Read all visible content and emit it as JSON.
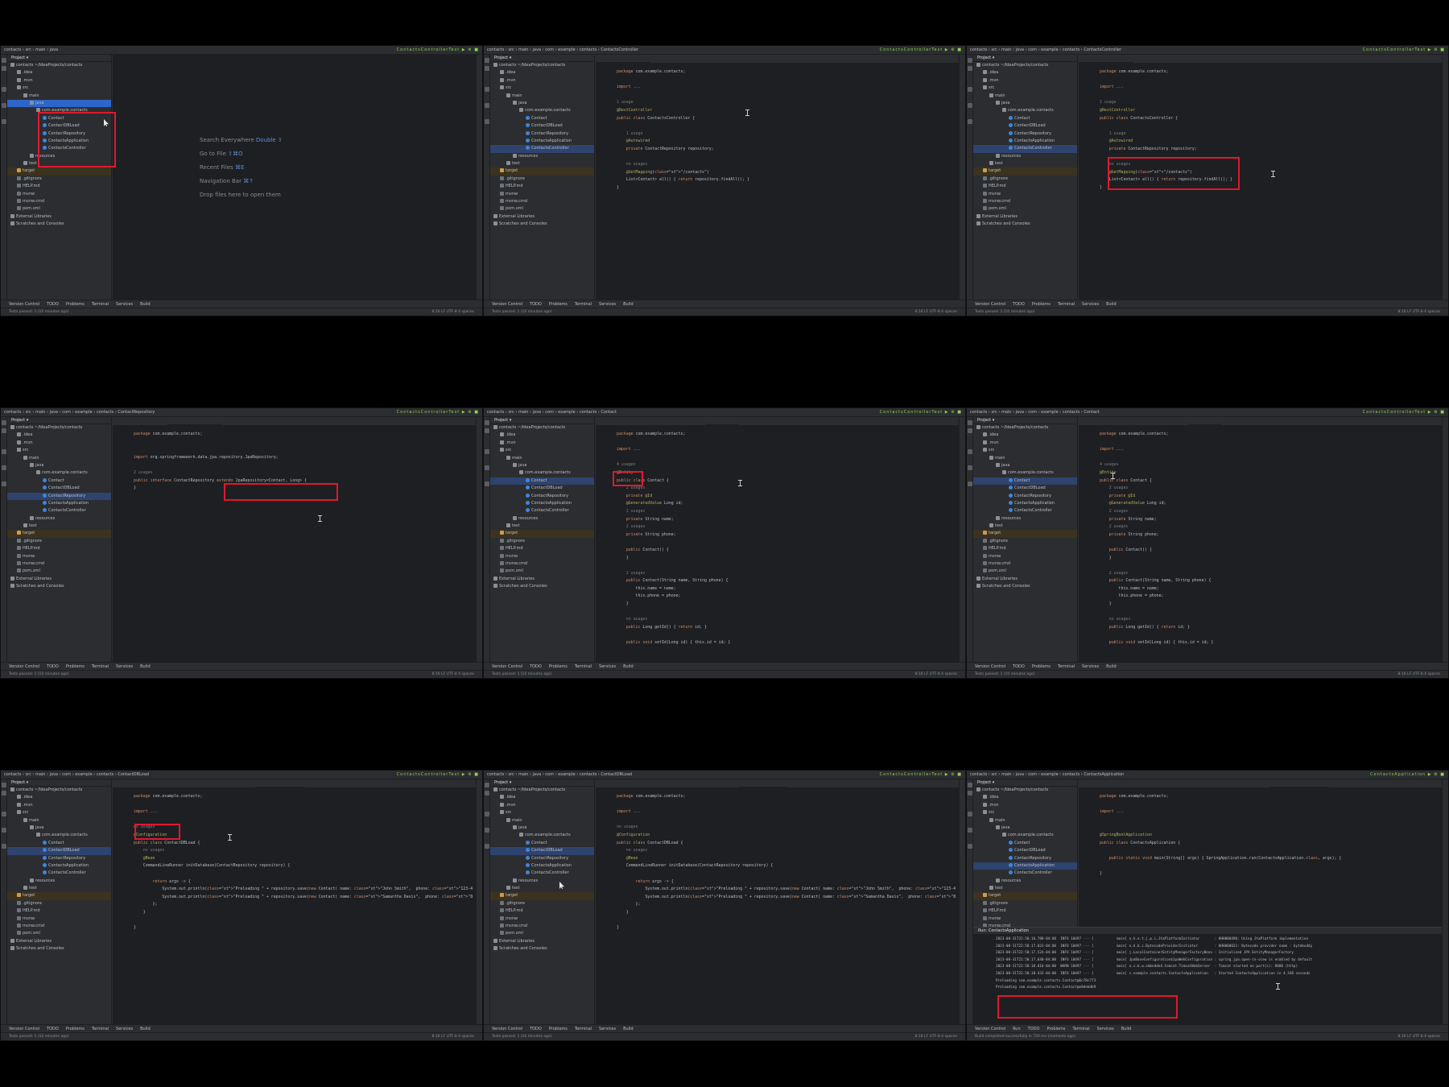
{
  "common": {
    "project_label": "Project",
    "project_root": "contacts",
    "project_root_path": "~/IdeaProjects/contacts",
    "bottom_tools": [
      "Version Control",
      "TODO",
      "Problems",
      "Terminal",
      "Services",
      "Build"
    ],
    "status_text": "Tests passed: 1 (10 minutes ago)",
    "status_right": "8:16   LF   UTF-8   4 spaces",
    "tree_items": [
      {
        "label": "contacts  ~/IdeaProjects/contacts",
        "indent": 0,
        "icon": "folder"
      },
      {
        "label": ".idea",
        "indent": 1,
        "icon": "folder"
      },
      {
        "label": ".mvn",
        "indent": 1,
        "icon": "folder"
      },
      {
        "label": "src",
        "indent": 1,
        "icon": "folder"
      },
      {
        "label": "main",
        "indent": 2,
        "icon": "folder"
      },
      {
        "label": "java",
        "indent": 3,
        "icon": "folder"
      },
      {
        "label": "com.example.contacts",
        "indent": 4,
        "icon": "folder"
      },
      {
        "label": "Contact",
        "indent": 5,
        "icon": "cls"
      },
      {
        "label": "ContactDBLoad",
        "indent": 5,
        "icon": "cls"
      },
      {
        "label": "ContactRepository",
        "indent": 5,
        "icon": "cls"
      },
      {
        "label": "ContactsApplication",
        "indent": 5,
        "icon": "cls"
      },
      {
        "label": "ContactsController",
        "indent": 5,
        "icon": "cls"
      },
      {
        "label": "resources",
        "indent": 3,
        "icon": "folder"
      },
      {
        "label": "test",
        "indent": 2,
        "icon": "folder"
      },
      {
        "label": "target",
        "indent": 1,
        "icon": "orangef"
      },
      {
        "label": ".gitignore",
        "indent": 1,
        "icon": "file"
      },
      {
        "label": "HELP.md",
        "indent": 1,
        "icon": "file"
      },
      {
        "label": "mvnw",
        "indent": 1,
        "icon": "file"
      },
      {
        "label": "mvnw.cmd",
        "indent": 1,
        "icon": "file"
      },
      {
        "label": "pom.xml",
        "indent": 1,
        "icon": "file"
      },
      {
        "label": "External Libraries",
        "indent": 0,
        "icon": "folder"
      },
      {
        "label": "Scratches and Consoles",
        "indent": 0,
        "icon": "folder"
      }
    ]
  },
  "panels": [
    {
      "breadcrumb": "contacts › src › main › java",
      "run_config": "ContactsControllerTest",
      "tabs": [],
      "active_tab": -1,
      "selected_tree": 5,
      "selected_style": "selbright",
      "empty_hints": [
        {
          "text": "Search Everywhere",
          "key": "Double ⇧"
        },
        {
          "text": "Go to File",
          "key": "⇧⌘O"
        },
        {
          "text": "Recent Files",
          "key": "⌘E"
        },
        {
          "text": "Navigation Bar",
          "key": "⌘↑"
        },
        {
          "text": "Drop files here to open them",
          "key": ""
        }
      ],
      "code": []
    },
    {
      "breadcrumb": "contacts › src › main › java › com › example › contacts › ContactsController",
      "run_config": "ContactsControllerTest",
      "tabs": [
        "ContactsController.java"
      ],
      "active_tab": 0,
      "selected_tree": 11,
      "selected_style": "sel",
      "code": [
        "package com.example.contacts;",
        "",
        "import ...",
        "",
        "1 usage",
        "@RestController",
        "public class ContactsController {",
        "",
        "    1 usage",
        "    @Autowired",
        "    private ContactRepository repository;",
        "",
        "    no usages",
        "    @GetMapping(\"/contacts\")",
        "    List<Contact> all() { return repository.findAll(); }",
        "}"
      ]
    },
    {
      "breadcrumb": "contacts › src › main › java › com › example › contacts › ContactsController",
      "run_config": "ContactsControllerTest",
      "tabs": [
        "ContactsController.java"
      ],
      "active_tab": 0,
      "selected_tree": 11,
      "selected_style": "sel",
      "code": [
        "package com.example.contacts;",
        "",
        "import ...",
        "",
        "1 usage",
        "@RestController",
        "public class ContactsController {",
        "",
        "    1 usage",
        "    @Autowired",
        "    private ContactRepository repository;",
        "",
        "    no usages",
        "    @GetMapping(\"/contacts\")",
        "    List<Contact> all() { return repository.findAll(); }",
        "}"
      ]
    },
    {
      "breadcrumb": "contacts › src › main › java › com › example › contacts › ContactRepository",
      "run_config": "ContactsControllerTest",
      "tabs": [
        "ContactsController.java",
        "ContactRepository.java"
      ],
      "active_tab": 1,
      "selected_tree": 9,
      "selected_style": "sel",
      "code": [
        "package com.example.contacts;",
        "",
        "",
        "import org.springframework.data.jpa.repository.JpaRepository;",
        "",
        "2 usages",
        "public interface ContactRepository extends JpaRepository<Contact, Long> {",
        "}"
      ]
    },
    {
      "breadcrumb": "contacts › src › main › java › com › example › contacts › Contact",
      "run_config": "ContactsControllerTest",
      "tabs": [
        "ContactsController.java",
        "ContactRepository.java",
        "Contact.java"
      ],
      "active_tab": 2,
      "selected_tree": 7,
      "selected_style": "sel",
      "code": [
        "package com.example.contacts;",
        "",
        "import ...",
        "",
        "4 usages",
        "@Entity",
        "public class Contact {",
        "    2 usages",
        "    private @Id",
        "    @GeneratedValue Long id;",
        "    2 usages",
        "    private String name;",
        "    2 usages",
        "    private String phone;",
        "",
        "    public Contact() {",
        "    }",
        "",
        "    2 usages",
        "    public Contact(String name, String phone) {",
        "        this.name = name;",
        "        this.phone = phone;",
        "    }",
        "",
        "    no usages",
        "    public Long getId() { return id; }",
        "",
        "    public void setId(Long id) { this.id = id; }"
      ]
    },
    {
      "breadcrumb": "contacts › src › main › java › com › example › contacts › Contact",
      "run_config": "ContactsControllerTest",
      "tabs": [
        "ContactsController.java",
        "ContactRepository.java",
        "Contact.java"
      ],
      "active_tab": 2,
      "selected_tree": 7,
      "selected_style": "sel",
      "code": [
        "package com.example.contacts;",
        "",
        "import ...",
        "",
        "4 usages",
        "@Entity",
        "public class Contact {",
        "    2 usages",
        "    private @Id",
        "    @GeneratedValue Long id;",
        "    2 usages",
        "    private String name;",
        "    2 usages",
        "    private String phone;",
        "",
        "    public Contact() {",
        "    }",
        "",
        "    2 usages",
        "    public Contact(String name, String phone) {",
        "        this.name = name;",
        "        this.phone = phone;",
        "    }",
        "",
        "    no usages",
        "    public Long getId() { return id; }",
        "",
        "    public void setId(Long id) { this.id = id; }"
      ]
    },
    {
      "breadcrumb": "contacts › src › main › java › com › example › contacts › ContactDBLoad",
      "run_config": "ContactsControllerTest",
      "tabs": [
        "ContactsController.java",
        "ContactRepository.java",
        "Contact.java",
        "ContactDBLoad.java"
      ],
      "active_tab": 3,
      "selected_tree": 8,
      "selected_style": "sel",
      "code": [
        "package com.example.contacts;",
        "",
        "import ...",
        "",
        "no usages",
        "@Configuration",
        "public class ContactDBLoad {",
        "    no usages",
        "    @Bean",
        "    CommandLineRunner initDatabase(ContactRepository repository) {",
        "",
        "        return args -> {",
        "            System.out.println(\"Preloading \" + repository.save(new Contact( name: \"John Smith\",  phone: \"123-456-7890\")));",
        "            System.out.println(\"Preloading \" + repository.save(new Contact( name: \"Samantha Davis\",  phone: \"890-765-4321\")));",
        "        };",
        "    }",
        "",
        "}"
      ]
    },
    {
      "breadcrumb": "contacts › src › main › java › com › example › contacts › ContactDBLoad",
      "run_config": "ContactsControllerTest",
      "tabs": [
        "ContactsController.java",
        "ContactRepository.java",
        "Contact.java",
        "ContactDBLoad.java"
      ],
      "active_tab": 3,
      "selected_tree": 8,
      "selected_style": "sel",
      "code": [
        "package com.example.contacts;",
        "",
        "import ...",
        "",
        "no usages",
        "@Configuration",
        "public class ContactDBLoad {",
        "    no usages",
        "    @Bean",
        "    CommandLineRunner initDatabase(ContactRepository repository) {",
        "",
        "        return args -> {",
        "            System.out.println(\"Preloading \" + repository.save(new Contact( name: \"John Smith\",  phone: \"123-456-7890\")));",
        "            System.out.println(\"Preloading \" + repository.save(new Contact( name: \"Samantha Davis\",  phone: \"890-765-4321\")));",
        "        };",
        "    }",
        "",
        "}"
      ]
    },
    {
      "breadcrumb": "contacts › src › main › java › com › example › contacts › ContactsApplication",
      "run_config": "ContactsApplication",
      "tabs": [
        "ContactsController.java",
        "ContactRepository.java",
        "Contact.java",
        "ContactDBLoad.java",
        "ContactsApplication.java"
      ],
      "active_tab": 4,
      "selected_tree": 10,
      "selected_style": "sel",
      "code": [
        "package com.example.contacts;",
        "",
        "import ...",
        "",
        "",
        "@SpringBootApplication",
        "public class ContactsApplication {",
        "",
        "    public static void main(String[] args) { SpringApplication.run(ContactsApplication.class, args); }",
        "",
        "}"
      ],
      "console_title": "ContactsApplication",
      "console_lines": [
        "2023-08-31T22:50:16.788-04:00  INFO 10497 --- [           main] o.h.e.t.j.p.i.JtaPlatformInitiator       : HHH000490: Using JtaPlatform implementation",
        "2023-08-31T22:50:17.023-04:00  INFO 10497 --- [           main] o.h.b.i.BytecodeProviderInitiator        : HHH000021: Bytecode provider name : bytebuddy",
        "2023-08-31T22:50:17.524-04:00  INFO 10497 --- [           main] j.LocalContainerEntityManagerFactoryBean : Initialized JPA EntityManagerFactory",
        "2023-08-31T22:50:17.640-04:00  INFO 10497 --- [           main] JpaBaseConfiguration$JpaWebConfiguration : spring.jpa.open-in-view is enabled by default",
        "2023-08-31T22:50:18.016-04:00  WARN 10497 --- [           main] o.s.b.w.embedded.tomcat.TomcatWebServer  : Tomcat started on port(s): 8080 (http)",
        "2023-08-31T22:50:18.433-04:00  INFO 10497 --- [           main] c.example.contacts.ContactsApplication   : Started ContactsApplication in 4.348 seconds",
        "Preloading com.example.contacts.Contact@6c70c773",
        "Preloading com.example.contacts.Contact@e0debdb9"
      ],
      "status_text": "Build completed successfully in 720 ms (moments ago)"
    }
  ]
}
